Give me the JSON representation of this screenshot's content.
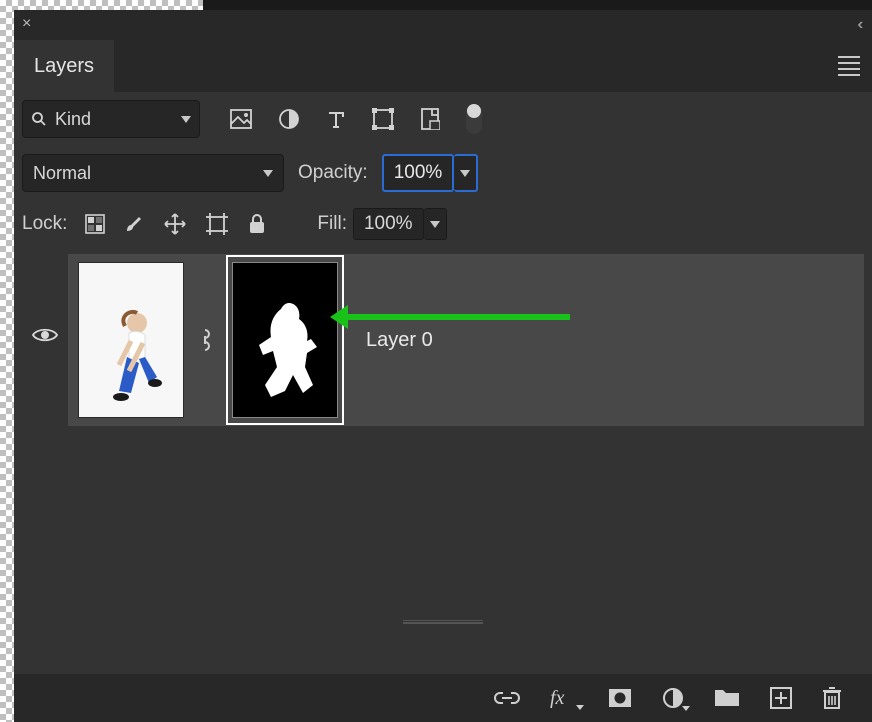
{
  "panel": {
    "tab_label": "Layers"
  },
  "filter": {
    "mode": "Kind",
    "icons": [
      "image-icon",
      "adjustment-icon",
      "type-icon",
      "shape-icon",
      "smartobject-icon"
    ]
  },
  "blend": {
    "mode": "Normal",
    "opacity_label": "Opacity:",
    "opacity_value": "100%"
  },
  "lock": {
    "label": "Lock:",
    "fill_label": "Fill:",
    "fill_value": "100%"
  },
  "layers": [
    {
      "visible": true,
      "linked": true,
      "has_mask": true,
      "mask_selected": true,
      "name": "Layer 0"
    }
  ],
  "bottom_icons": [
    "link-icon",
    "fx-icon",
    "mask-icon",
    "adjustment-layer-icon",
    "group-icon",
    "new-layer-icon",
    "trash-icon"
  ],
  "annotation": {
    "arrow_target": "layer-mask-thumbnail",
    "arrow_color": "#18c218"
  }
}
